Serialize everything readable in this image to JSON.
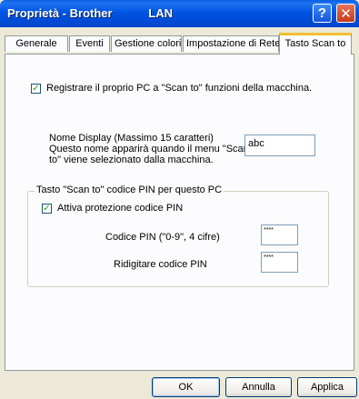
{
  "window": {
    "title": "Proprietà - Brother           LAN",
    "help_glyph": "?",
    "close_glyph": "✕"
  },
  "tabs": [
    {
      "label": "Generale"
    },
    {
      "label": "Eventi"
    },
    {
      "label": "Gestione colori"
    },
    {
      "label": "Impostazione di Rete"
    },
    {
      "label": "Tasto Scan to"
    }
  ],
  "register": {
    "checked": true,
    "label": "Registrare il proprio PC a \"Scan to\" funzioni della macchina."
  },
  "display_name": {
    "line1": "Nome Display (Massimo 15 caratteri)",
    "line2": "Questo nome apparirà quando il menu \"Scan",
    "line3": "to\" viene selezionato dalla macchina.",
    "value": "abc"
  },
  "pin_group": {
    "title": "Tasto \"Scan to\" codice PIN per questo PC",
    "protect_checked": true,
    "protect_label": "Attiva protezione codice PIN",
    "pin_label": "Codice PIN (\"0-9\", 4 cifre)",
    "pin_value": "****",
    "retype_label": "Ridigitare codice PIN",
    "retype_value": "****"
  },
  "buttons": {
    "ok": "OK",
    "cancel": "Annulla",
    "apply": "Applica"
  }
}
